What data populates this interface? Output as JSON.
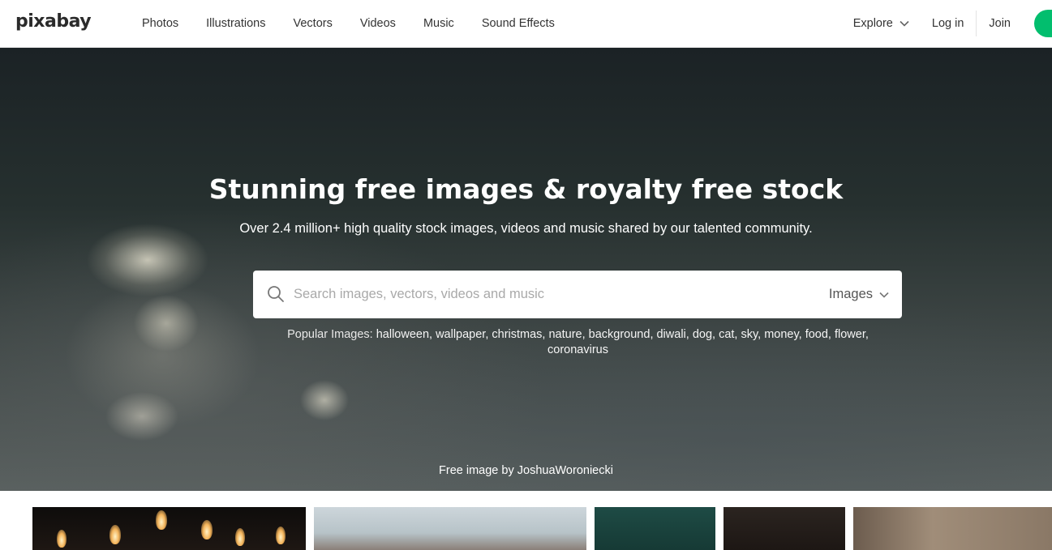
{
  "header": {
    "logo": "pixabay",
    "nav": [
      "Photos",
      "Illustrations",
      "Vectors",
      "Videos",
      "Music",
      "Sound Effects"
    ],
    "explore_label": "Explore",
    "login_label": "Log in",
    "join_label": "Join"
  },
  "hero": {
    "title": "Stunning free images & royalty free stock",
    "subtitle": "Over 2.4 million+ high quality stock images, videos and music shared by our talented community.",
    "search": {
      "placeholder": "Search images, vectors, videos and music",
      "value": "",
      "type_label": "Images"
    },
    "popular_prefix": "Popular Images:",
    "popular_tags": "halloween, wallpaper, christmas, nature, background, diwali, dog, cat, sky, money, food, flower, coronavirus",
    "credit_prefix": "Free image by",
    "credit_author": "JoshuaWoroniecki"
  },
  "colors": {
    "upload_accent": "#02be6e",
    "header_bg": "#ffffff"
  },
  "icons": {
    "search": "search-icon",
    "explore_chevron": "chevron-down-icon",
    "type_chevron": "chevron-down-icon"
  }
}
